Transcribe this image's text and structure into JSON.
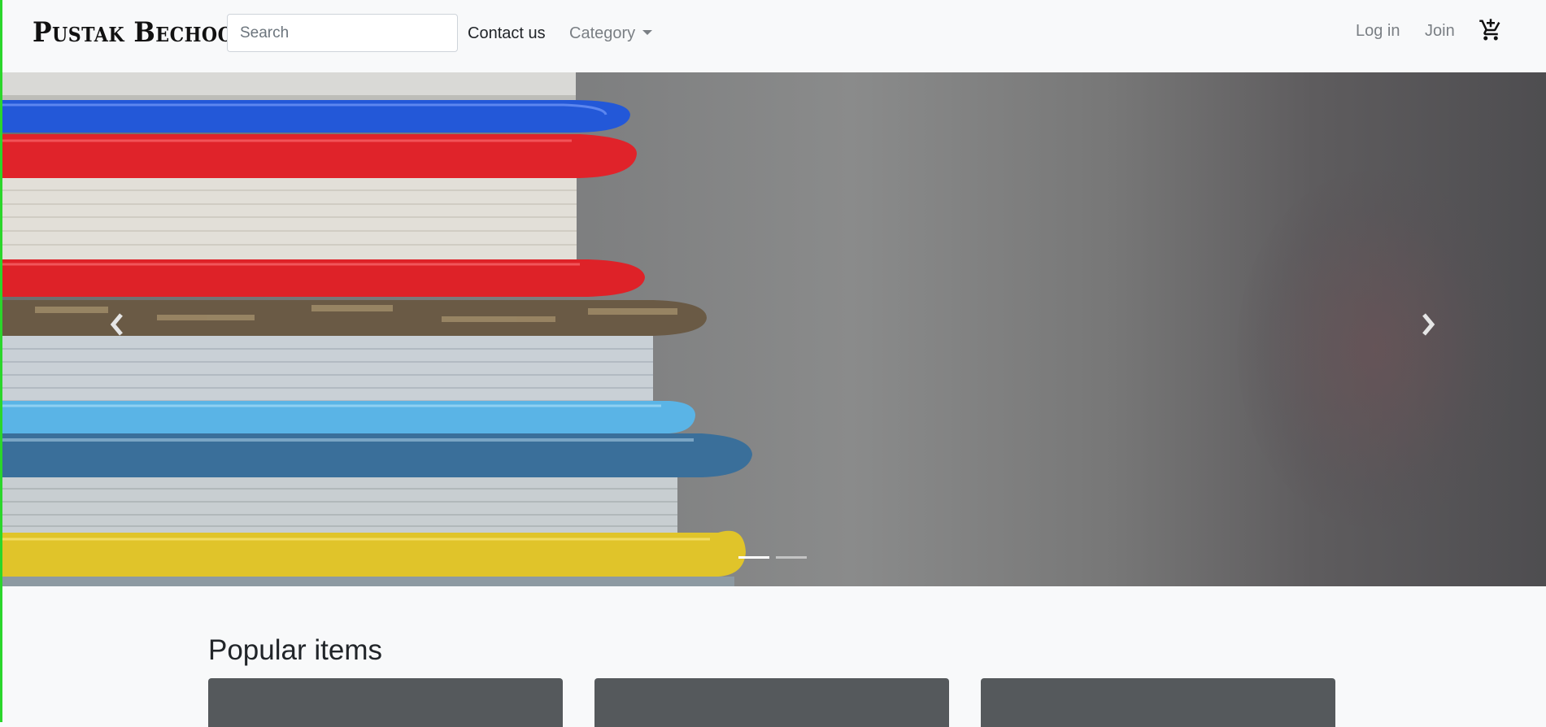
{
  "navbar": {
    "brand": "Pustak Bechoo",
    "search_placeholder": "Search",
    "contact_label": "Contact us",
    "category_label": "Category",
    "login_label": "Log in",
    "join_label": "Join",
    "cart_icon": "add-shopping-cart-icon"
  },
  "carousel": {
    "slide_count": 2,
    "active_slide": 1,
    "prev_icon": "chevron-left-icon",
    "next_icon": "chevron-right-icon"
  },
  "popular": {
    "title": "Popular items",
    "cards": [
      {
        "name": "popular-card-1"
      },
      {
        "name": "popular-card-2"
      },
      {
        "name": "popular-card-3"
      }
    ]
  },
  "colors": {
    "page_bg": "#f8f9fa",
    "card_bg": "#55595c",
    "accent_strip": "#2bd62b",
    "nav_muted": "#7a7f84"
  }
}
